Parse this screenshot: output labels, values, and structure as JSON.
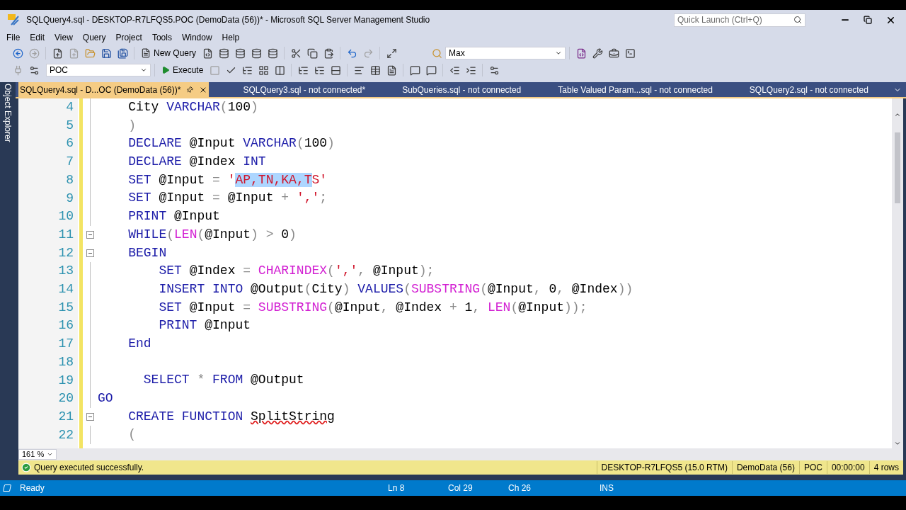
{
  "window": {
    "title": "SQLQuery4.sql - DESKTOP-R7LFQS5.POC (DemoData (56))* - Microsoft SQL Server Management Studio",
    "quick_launch": {
      "placeholder": "Quick Launch (Ctrl+Q)"
    }
  },
  "menu": [
    "File",
    "Edit",
    "View",
    "Query",
    "Project",
    "Tools",
    "Window",
    "Help"
  ],
  "toolbar": {
    "new_query": "New Query",
    "search_box": "Max",
    "database": "POC",
    "execute": "Execute"
  },
  "side_tab": "Object Explorer",
  "tabs": [
    {
      "label": "SQLQuery4.sql - D...OC (DemoData (56))*",
      "selected": true
    },
    {
      "label": "SQLQuery3.sql - not connected*",
      "selected": false
    },
    {
      "label": "SubQueries.sql - not connected",
      "selected": false
    },
    {
      "label": "Table Valued Param...sql - not connected",
      "selected": false
    },
    {
      "label": "SQLQuery2.sql - not connected",
      "selected": false
    }
  ],
  "editor": {
    "zoom": "161 %",
    "lines": [
      {
        "number": "4",
        "foldable": false,
        "tokens": [
          {
            "kind": "plain",
            "text": "    City "
          },
          {
            "kind": "keyword",
            "text": "VARCHAR"
          },
          {
            "kind": "operator",
            "text": "("
          },
          {
            "kind": "plain",
            "text": "100"
          },
          {
            "kind": "operator",
            "text": ")"
          }
        ]
      },
      {
        "number": "5",
        "foldable": false,
        "tokens": [
          {
            "kind": "operator",
            "text": "    )"
          }
        ]
      },
      {
        "number": "6",
        "foldable": false,
        "tokens": [
          {
            "kind": "keyword",
            "text": "    DECLARE"
          },
          {
            "kind": "plain",
            "text": " @Input "
          },
          {
            "kind": "keyword",
            "text": "VARCHAR"
          },
          {
            "kind": "operator",
            "text": "("
          },
          {
            "kind": "plain",
            "text": "100"
          },
          {
            "kind": "operator",
            "text": ")"
          }
        ]
      },
      {
        "number": "7",
        "foldable": false,
        "tokens": [
          {
            "kind": "keyword",
            "text": "    DECLARE"
          },
          {
            "kind": "plain",
            "text": " @Index "
          },
          {
            "kind": "keyword",
            "text": "INT"
          }
        ]
      },
      {
        "number": "8",
        "foldable": false,
        "tokens": [
          {
            "kind": "keyword",
            "text": "    SET"
          },
          {
            "kind": "plain",
            "text": " @Input "
          },
          {
            "kind": "operator",
            "text": "="
          },
          {
            "kind": "string",
            "text": " '"
          },
          {
            "kind": "string",
            "text": "AP,TN,KA,T",
            "selected": true
          },
          {
            "kind": "string",
            "text": "S'"
          }
        ]
      },
      {
        "number": "9",
        "foldable": false,
        "tokens": [
          {
            "kind": "keyword",
            "text": "    SET"
          },
          {
            "kind": "plain",
            "text": " @Input "
          },
          {
            "kind": "operator",
            "text": "="
          },
          {
            "kind": "plain",
            "text": " @Input "
          },
          {
            "kind": "operator",
            "text": "+"
          },
          {
            "kind": "string",
            "text": " ','"
          },
          {
            "kind": "operator",
            "text": ";"
          }
        ]
      },
      {
        "number": "10",
        "foldable": false,
        "tokens": [
          {
            "kind": "keyword",
            "text": "    PRINT"
          },
          {
            "kind": "plain",
            "text": " @Input"
          }
        ]
      },
      {
        "number": "11",
        "foldable": true,
        "tokens": [
          {
            "kind": "keyword",
            "text": "    WHILE"
          },
          {
            "kind": "operator",
            "text": "("
          },
          {
            "kind": "function",
            "text": "LEN"
          },
          {
            "kind": "operator",
            "text": "("
          },
          {
            "kind": "plain",
            "text": "@Input"
          },
          {
            "kind": "operator",
            "text": ") >"
          },
          {
            "kind": "plain",
            "text": " 0"
          },
          {
            "kind": "operator",
            "text": ")"
          }
        ]
      },
      {
        "number": "12",
        "foldable": true,
        "tokens": [
          {
            "kind": "keyword",
            "text": "    BEGIN"
          }
        ]
      },
      {
        "number": "13",
        "foldable": false,
        "tokens": [
          {
            "kind": "keyword",
            "text": "        SET"
          },
          {
            "kind": "plain",
            "text": " @Index "
          },
          {
            "kind": "operator",
            "text": "="
          },
          {
            "kind": "function",
            "text": " CHARINDEX"
          },
          {
            "kind": "operator",
            "text": "("
          },
          {
            "kind": "string",
            "text": "','"
          },
          {
            "kind": "operator",
            "text": ","
          },
          {
            "kind": "plain",
            "text": " @Input"
          },
          {
            "kind": "operator",
            "text": ");"
          }
        ]
      },
      {
        "number": "14",
        "foldable": false,
        "tokens": [
          {
            "kind": "keyword",
            "text": "        INSERT INTO"
          },
          {
            "kind": "plain",
            "text": " @Output"
          },
          {
            "kind": "operator",
            "text": "("
          },
          {
            "kind": "plain",
            "text": "City"
          },
          {
            "kind": "operator",
            "text": ")"
          },
          {
            "kind": "keyword",
            "text": " VALUES"
          },
          {
            "kind": "operator",
            "text": "("
          },
          {
            "kind": "function",
            "text": "SUBSTRING"
          },
          {
            "kind": "operator",
            "text": "("
          },
          {
            "kind": "plain",
            "text": "@Input"
          },
          {
            "kind": "operator",
            "text": ","
          },
          {
            "kind": "plain",
            "text": " 0"
          },
          {
            "kind": "operator",
            "text": ","
          },
          {
            "kind": "plain",
            "text": " @Index"
          },
          {
            "kind": "operator",
            "text": "))"
          }
        ]
      },
      {
        "number": "15",
        "foldable": false,
        "tokens": [
          {
            "kind": "keyword",
            "text": "        SET"
          },
          {
            "kind": "plain",
            "text": " @Input "
          },
          {
            "kind": "operator",
            "text": "="
          },
          {
            "kind": "function",
            "text": " SUBSTRING"
          },
          {
            "kind": "operator",
            "text": "("
          },
          {
            "kind": "plain",
            "text": "@Input"
          },
          {
            "kind": "operator",
            "text": ","
          },
          {
            "kind": "plain",
            "text": " @Index "
          },
          {
            "kind": "operator",
            "text": "+"
          },
          {
            "kind": "plain",
            "text": " 1"
          },
          {
            "kind": "operator",
            "text": ","
          },
          {
            "kind": "function",
            "text": " LEN"
          },
          {
            "kind": "operator",
            "text": "("
          },
          {
            "kind": "plain",
            "text": "@Input"
          },
          {
            "kind": "operator",
            "text": "));"
          }
        ]
      },
      {
        "number": "16",
        "foldable": false,
        "tokens": [
          {
            "kind": "keyword",
            "text": "        PRINT"
          },
          {
            "kind": "plain",
            "text": " @Input"
          }
        ]
      },
      {
        "number": "17",
        "foldable": false,
        "tokens": [
          {
            "kind": "keyword",
            "text": "    End"
          }
        ]
      },
      {
        "number": "18",
        "foldable": false
      },
      {
        "number": "19",
        "foldable": false,
        "tokens": [
          {
            "kind": "keyword",
            "text": "      SELECT"
          },
          {
            "kind": "operator",
            "text": " *"
          },
          {
            "kind": "keyword",
            "text": " FROM"
          },
          {
            "kind": "plain",
            "text": " @Output"
          }
        ]
      },
      {
        "number": "20",
        "foldable": false,
        "tokens": [
          {
            "kind": "keyword",
            "text": "GO"
          }
        ]
      },
      {
        "number": "21",
        "foldable": true,
        "tokens": [
          {
            "kind": "keyword",
            "text": "    CREATE FUNCTION "
          },
          {
            "kind": "plain",
            "text": "SplitString",
            "error": true
          }
        ]
      },
      {
        "number": "22",
        "foldable": false,
        "tokens": [
          {
            "kind": "operator",
            "text": "    ("
          }
        ]
      }
    ]
  },
  "result_bar": {
    "message": "Query executed successfully.",
    "segments": [
      "DESKTOP-R7LFQS5 (15.0 RTM)",
      "DemoData (56)",
      "POC",
      "00:00:00",
      "4 rows"
    ]
  },
  "status_bar": {
    "state": "Ready",
    "line": "Ln 8",
    "column": "Col 29",
    "char": "Ch 26",
    "mode": "INS"
  }
}
